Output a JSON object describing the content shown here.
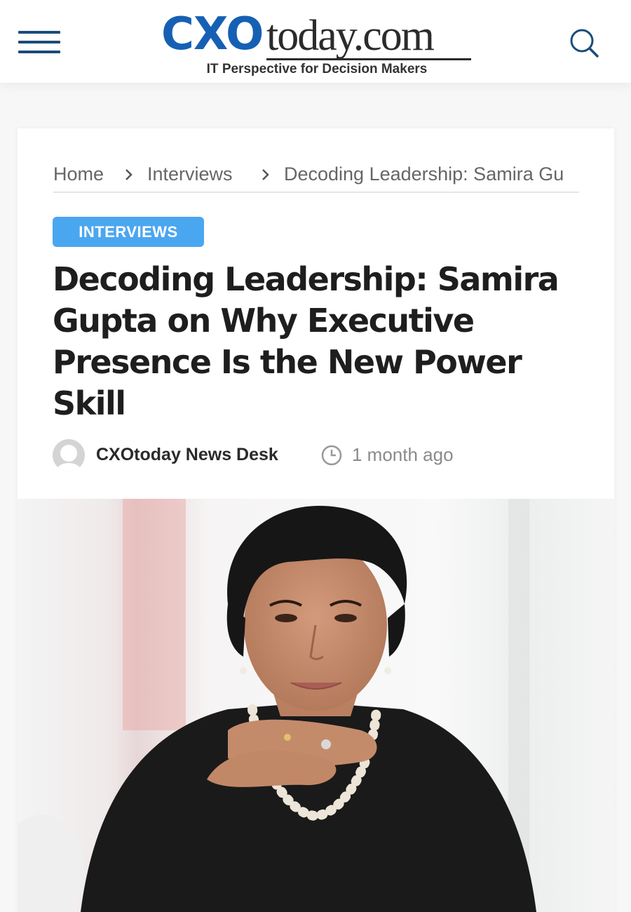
{
  "header": {
    "logo_cxo": "CXO",
    "logo_domain": "today.com",
    "logo_tagline": "IT Perspective for Decision Makers",
    "menu_icon": "hamburger-menu-icon",
    "search_icon": "search-icon",
    "brand_color": "#1660b4"
  },
  "breadcrumb": {
    "items": [
      "Home",
      "Interviews",
      "Decoding Leadership: Samira Gu"
    ],
    "separator_icon": "chevron-right-icon"
  },
  "article": {
    "category": "INTERVIEWS",
    "category_color": "#4ba6f0",
    "title": "Decoding Leadership: Samira Gupta on Why Executive Presence Is the New Power Skill",
    "author": "CXOtoday News Desk",
    "author_icon": "avatar-placeholder-icon",
    "time_icon": "clock-icon",
    "time_ago": "1 month ago",
    "image_subject": "portrait-photo"
  }
}
